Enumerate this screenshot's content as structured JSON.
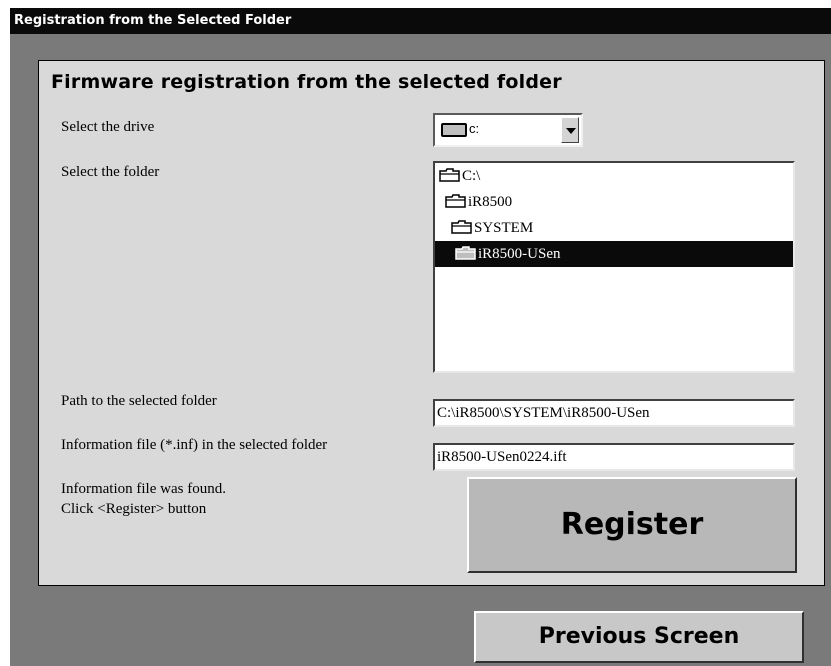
{
  "window": {
    "title": "Registration from the Selected Folder"
  },
  "panel": {
    "heading": "Firmware registration from the selected folder",
    "drive_label": "Select the drive",
    "drive_value": "c:",
    "folder_label": "Select the folder",
    "folders": [
      {
        "name": "C:\\",
        "selected": false,
        "icon": "open-folder-icon"
      },
      {
        "name": "iR8500",
        "selected": false,
        "icon": "open-folder-icon"
      },
      {
        "name": "SYSTEM",
        "selected": false,
        "icon": "open-folder-icon"
      },
      {
        "name": "iR8500-USen",
        "selected": true,
        "icon": "open-folder-icon"
      }
    ],
    "path_label": "Path to the selected folder",
    "path_value": "C:\\iR8500\\SYSTEM\\iR8500-USen",
    "info_label": "Information file (*.inf) in the selected folder",
    "info_value": "iR8500-USen0224.ift",
    "status_line1": "Information file was found.",
    "status_line2": "Click <Register> button",
    "register_label": "Register"
  },
  "footer": {
    "previous_label": "Previous Screen"
  },
  "colors": {
    "background": "#7a7a7a",
    "panel": "#d9d9d9",
    "selection": "#0a0a0a",
    "titlebar": "#0a0a0a"
  }
}
